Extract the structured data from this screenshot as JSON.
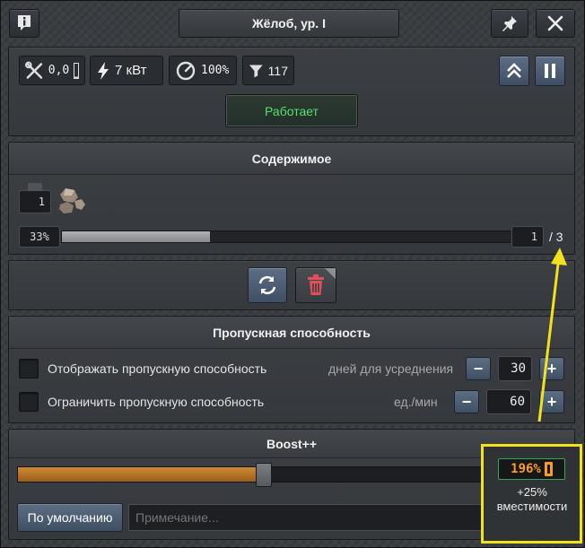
{
  "window": {
    "title": "Жёлоб, ур. I"
  },
  "stats": {
    "throughput_value": "0,0",
    "power_value": "7 кВт",
    "efficiency_value": "100%",
    "filter_value": "117"
  },
  "status": {
    "label": "Работает",
    "color": "#57e06b"
  },
  "contents": {
    "title": "Содержимое",
    "slot_count": "1",
    "fill_percent_label": "33%",
    "fill_fraction": 0.33,
    "current": "1",
    "capacity_label": "/ 3"
  },
  "throughput": {
    "title": "Пропускная способность",
    "show_label": "Отображать пропускную способность",
    "days_label": "дней для усреднения",
    "days_value": "30",
    "limit_label": "Ограничить пропускную способность",
    "rate_label": "ед./мин",
    "rate_value": "60",
    "minus": "−",
    "plus": "+"
  },
  "boost": {
    "title": "Boost++",
    "fill_fraction": 0.52,
    "default_button": "По умолчанию",
    "note_placeholder": "Примечание...",
    "percent": "196%",
    "description": "+25% вместимости",
    "accent": "#ff9b1e"
  },
  "annotation": {
    "highlight_color": "#f1e21c"
  }
}
